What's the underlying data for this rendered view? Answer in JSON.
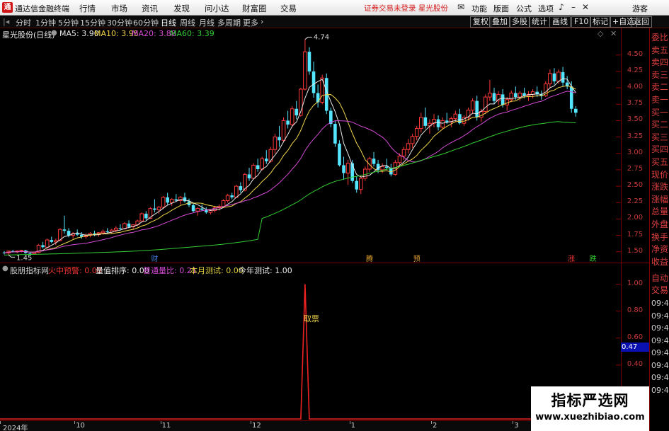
{
  "window": {
    "title": "通达信金融终端",
    "menu": [
      "行情",
      "市场",
      "资讯",
      "发现",
      "问小达",
      "财富圈",
      "交易"
    ],
    "notice": "证券交易未登录  星光股份",
    "right_menu": [
      "功能",
      "版面",
      "公式",
      "选项"
    ],
    "user": "游客"
  },
  "toolbar": {
    "periods": [
      "分时",
      "1分钟",
      "5分钟",
      "15分钟",
      "30分钟",
      "60分钟",
      "日线",
      "周线",
      "月线",
      "多周期",
      "更多"
    ],
    "active_period": "日线",
    "right_buttons": [
      "复权",
      "叠加",
      "多股",
      "统计",
      "画线",
      "F10",
      "标记",
      "+自选",
      "返回"
    ]
  },
  "main_chart": {
    "stock_label": "星光股份(日线)",
    "ma_legend": [
      {
        "label": "MA5: 3.90",
        "color": "#e8e8e8"
      },
      {
        "label": "MA10: 3.95",
        "color": "#f0d64a"
      },
      {
        "label": "MA20: 3.88",
        "color": "#d44ad4"
      },
      {
        "label": "MA60: 3.39",
        "color": "#33cc33"
      }
    ],
    "high_label": "4.74",
    "low_label": "1.45",
    "event_markers": [
      {
        "text": "财",
        "color": "#3a7ad8",
        "x_index": 35
      },
      {
        "text": "腾",
        "color": "#e0a030",
        "x_index": 85
      },
      {
        "text": "预",
        "color": "#e0a030",
        "x_index": 96
      },
      {
        "text": "涨",
        "color": "#ee3333",
        "x_index": 132
      },
      {
        "text": "跌",
        "color": "#33cc33",
        "x_index": 137
      }
    ]
  },
  "price_axis": [
    "4.50",
    "4.25",
    "4.00",
    "3.75",
    "3.50",
    "3.25",
    "3.00",
    "2.75",
    "2.50",
    "2.25",
    "2.00",
    "1.75",
    "1.50"
  ],
  "indicator": {
    "legend": [
      {
        "label": "股朋指标网",
        "color": "#cccccc"
      },
      {
        "label": "火中预警: 0.00",
        "color": "#ee3333"
      },
      {
        "label": "量值排序: 0.00",
        "color": "#e8e8e8"
      },
      {
        "label": "普通量比: 0.21",
        "color": "#d44ad4"
      },
      {
        "label": "本月测试: 0.00",
        "color": "#e0d040"
      },
      {
        "label": "今年测试: 1.00",
        "color": "#e8e8e8"
      }
    ],
    "axis": [
      "1.00",
      "0.80",
      "0.60",
      "0.40",
      "0.20",
      "0.00"
    ],
    "current_value": "0.47",
    "peak_label": "取票"
  },
  "right_panel": {
    "quote_labels": [
      "委比",
      "卖五",
      "卖四",
      "卖三",
      "卖二",
      "卖一",
      "买一",
      "买二",
      "买三",
      "买四",
      "买五",
      "现价",
      "涨跌",
      "涨幅",
      "总量",
      "外盘",
      "换手",
      "净资",
      "收益"
    ],
    "trade_labels": [
      "自动",
      "交易"
    ],
    "times": [
      "09:43",
      "09:43",
      "09:43",
      "09:43",
      "09:43",
      "09:43",
      "09:43",
      "09:43"
    ]
  },
  "date_axis": [
    {
      "label": "2024年",
      "x_index": 0
    },
    {
      "label": "10",
      "x_index": 17
    },
    {
      "label": "11",
      "x_index": 37
    },
    {
      "label": "12",
      "x_index": 58
    },
    {
      "label": "1",
      "x_index": 81
    },
    {
      "label": "2",
      "x_index": 100
    },
    {
      "label": "3",
      "x_index": 119
    }
  ],
  "watermark": {
    "title": "指标严选网",
    "url": "www.xuezhibiao.com"
  },
  "chart_data": {
    "type": "candlestick",
    "ylim": [
      1.4,
      4.8
    ],
    "candles_ohlc": [
      [
        1.49,
        1.51,
        1.46,
        1.48
      ],
      [
        1.48,
        1.52,
        1.45,
        1.51
      ],
      [
        1.51,
        1.53,
        1.49,
        1.5
      ],
      [
        1.5,
        1.52,
        1.48,
        1.51
      ],
      [
        1.51,
        1.53,
        1.49,
        1.52
      ],
      [
        1.52,
        1.53,
        1.47,
        1.48
      ],
      [
        1.48,
        1.5,
        1.45,
        1.47
      ],
      [
        1.47,
        1.5,
        1.46,
        1.49
      ],
      [
        1.49,
        1.62,
        1.48,
        1.6
      ],
      [
        1.6,
        1.65,
        1.55,
        1.57
      ],
      [
        1.57,
        1.7,
        1.55,
        1.68
      ],
      [
        1.68,
        1.73,
        1.63,
        1.65
      ],
      [
        1.65,
        1.7,
        1.6,
        1.67
      ],
      [
        1.67,
        1.86,
        1.66,
        1.84
      ],
      [
        1.84,
        2.05,
        1.78,
        1.82
      ],
      [
        1.82,
        1.86,
        1.72,
        1.75
      ],
      [
        1.75,
        1.8,
        1.7,
        1.78
      ],
      [
        1.78,
        1.84,
        1.74,
        1.76
      ],
      [
        1.76,
        1.8,
        1.7,
        1.73
      ],
      [
        1.73,
        1.78,
        1.7,
        1.75
      ],
      [
        1.75,
        1.8,
        1.72,
        1.78
      ],
      [
        1.78,
        1.82,
        1.74,
        1.76
      ],
      [
        1.76,
        1.8,
        1.73,
        1.79
      ],
      [
        1.79,
        1.84,
        1.76,
        1.81
      ],
      [
        1.81,
        1.86,
        1.78,
        1.8
      ],
      [
        1.8,
        1.85,
        1.77,
        1.83
      ],
      [
        1.83,
        1.89,
        1.8,
        1.86
      ],
      [
        1.86,
        1.92,
        1.83,
        1.85
      ],
      [
        1.85,
        1.95,
        1.84,
        1.93
      ],
      [
        1.93,
        1.98,
        1.86,
        1.88
      ],
      [
        1.88,
        1.92,
        1.85,
        1.91
      ],
      [
        1.91,
        1.99,
        1.89,
        1.97
      ],
      [
        1.97,
        2.1,
        1.96,
        2.08
      ],
      [
        2.08,
        2.12,
        1.98,
        2.01
      ],
      [
        2.01,
        2.18,
        2.0,
        2.16
      ],
      [
        2.16,
        2.3,
        2.1,
        2.14
      ],
      [
        2.14,
        2.2,
        2.08,
        2.18
      ],
      [
        2.18,
        2.35,
        2.15,
        2.33
      ],
      [
        2.33,
        2.4,
        2.22,
        2.25
      ],
      [
        2.25,
        2.32,
        2.2,
        2.3
      ],
      [
        2.3,
        2.38,
        2.26,
        2.28
      ],
      [
        2.28,
        2.35,
        2.22,
        2.33
      ],
      [
        2.33,
        2.4,
        2.25,
        2.27
      ],
      [
        2.27,
        2.31,
        2.18,
        2.21
      ],
      [
        2.21,
        2.25,
        2.1,
        2.12
      ],
      [
        2.12,
        2.18,
        2.05,
        2.16
      ],
      [
        2.16,
        2.22,
        2.12,
        2.14
      ],
      [
        2.14,
        2.18,
        2.08,
        2.1
      ],
      [
        2.1,
        2.15,
        2.07,
        2.13
      ],
      [
        2.13,
        2.2,
        2.1,
        2.17
      ],
      [
        2.17,
        2.22,
        2.13,
        2.19
      ],
      [
        2.19,
        2.3,
        2.17,
        2.28
      ],
      [
        2.28,
        2.38,
        2.25,
        2.36
      ],
      [
        2.36,
        2.4,
        2.3,
        2.33
      ],
      [
        2.33,
        2.52,
        2.32,
        2.5
      ],
      [
        2.5,
        2.56,
        2.4,
        2.44
      ],
      [
        2.44,
        2.7,
        2.42,
        2.68
      ],
      [
        2.68,
        2.78,
        2.58,
        2.62
      ],
      [
        2.62,
        2.85,
        2.6,
        2.82
      ],
      [
        2.82,
        2.92,
        2.72,
        2.76
      ],
      [
        2.76,
        2.95,
        2.74,
        2.92
      ],
      [
        2.92,
        3.05,
        2.84,
        2.88
      ],
      [
        2.88,
        3.1,
        2.86,
        3.06
      ],
      [
        3.06,
        3.3,
        3.0,
        3.25
      ],
      [
        3.25,
        3.42,
        3.1,
        3.2
      ],
      [
        3.2,
        3.55,
        3.18,
        3.5
      ],
      [
        3.5,
        3.65,
        3.38,
        3.44
      ],
      [
        3.44,
        3.72,
        3.4,
        3.68
      ],
      [
        3.68,
        3.8,
        3.52,
        3.58
      ],
      [
        3.58,
        4.0,
        3.56,
        3.98
      ],
      [
        3.98,
        4.74,
        3.96,
        4.55
      ],
      [
        4.55,
        4.62,
        4.2,
        4.25
      ],
      [
        4.25,
        4.4,
        3.85,
        3.92
      ],
      [
        3.92,
        4.05,
        3.7,
        3.78
      ],
      [
        3.78,
        4.2,
        3.75,
        4.15
      ],
      [
        4.15,
        4.22,
        3.6,
        3.65
      ],
      [
        3.65,
        3.7,
        3.4,
        3.45
      ],
      [
        3.45,
        3.5,
        3.1,
        3.15
      ],
      [
        3.15,
        3.2,
        2.8,
        2.82
      ],
      [
        2.82,
        2.95,
        2.6,
        2.7
      ],
      [
        2.7,
        2.9,
        2.52,
        2.85
      ],
      [
        2.85,
        2.9,
        2.55,
        2.58
      ],
      [
        2.58,
        2.65,
        2.4,
        2.45
      ],
      [
        2.45,
        2.66,
        2.38,
        2.62
      ],
      [
        2.62,
        2.8,
        2.58,
        2.76
      ],
      [
        2.76,
        2.95,
        2.72,
        2.92
      ],
      [
        2.92,
        3.02,
        2.8,
        2.84
      ],
      [
        2.84,
        2.9,
        2.7,
        2.75
      ],
      [
        2.75,
        2.85,
        2.7,
        2.8
      ],
      [
        2.8,
        2.92,
        2.75,
        2.78
      ],
      [
        2.78,
        2.84,
        2.65,
        2.68
      ],
      [
        2.68,
        2.9,
        2.66,
        2.86
      ],
      [
        2.86,
        3.0,
        2.82,
        2.96
      ],
      [
        2.96,
        3.1,
        2.9,
        3.06
      ],
      [
        3.06,
        3.22,
        3.0,
        3.15
      ],
      [
        3.15,
        3.3,
        3.08,
        3.26
      ],
      [
        3.26,
        3.42,
        3.2,
        3.38
      ],
      [
        3.38,
        3.62,
        3.32,
        3.55
      ],
      [
        3.55,
        3.7,
        3.38,
        3.42
      ],
      [
        3.42,
        3.52,
        3.3,
        3.46
      ],
      [
        3.46,
        3.6,
        3.4,
        3.52
      ],
      [
        3.52,
        3.58,
        3.35,
        3.4
      ],
      [
        3.4,
        3.55,
        3.36,
        3.5
      ],
      [
        3.5,
        3.62,
        3.45,
        3.48
      ],
      [
        3.48,
        3.56,
        3.4,
        3.53
      ],
      [
        3.53,
        3.65,
        3.48,
        3.6
      ],
      [
        3.6,
        3.68,
        3.44,
        3.46
      ],
      [
        3.46,
        3.58,
        3.42,
        3.55
      ],
      [
        3.55,
        3.7,
        3.5,
        3.66
      ],
      [
        3.66,
        3.84,
        3.6,
        3.8
      ],
      [
        3.8,
        3.88,
        3.5,
        3.55
      ],
      [
        3.55,
        3.68,
        3.48,
        3.64
      ],
      [
        3.64,
        3.9,
        3.6,
        3.86
      ],
      [
        3.86,
        4.12,
        3.8,
        3.92
      ],
      [
        3.92,
        4.0,
        3.75,
        3.8
      ],
      [
        3.8,
        3.95,
        3.74,
        3.9
      ],
      [
        3.9,
        3.98,
        3.7,
        3.74
      ],
      [
        3.74,
        3.86,
        3.65,
        3.82
      ],
      [
        3.82,
        3.96,
        3.78,
        3.92
      ],
      [
        3.92,
        4.02,
        3.82,
        3.86
      ],
      [
        3.86,
        3.95,
        3.8,
        3.92
      ],
      [
        3.92,
        4.0,
        3.84,
        3.88
      ],
      [
        3.88,
        3.95,
        3.8,
        3.9
      ],
      [
        3.9,
        3.98,
        3.84,
        3.94
      ],
      [
        3.94,
        4.02,
        3.86,
        3.9
      ],
      [
        3.9,
        3.96,
        3.82,
        3.88
      ],
      [
        3.88,
        4.1,
        3.86,
        4.06
      ],
      [
        4.06,
        4.28,
        4.0,
        4.22
      ],
      [
        4.22,
        4.3,
        4.05,
        4.1
      ],
      [
        4.1,
        4.28,
        4.06,
        4.24
      ],
      [
        4.24,
        4.32,
        4.02,
        4.08
      ],
      [
        4.08,
        4.18,
        3.98,
        4.02
      ],
      [
        4.02,
        4.1,
        3.62,
        3.68
      ],
      [
        3.68,
        3.72,
        3.56,
        3.62
      ]
    ],
    "ma_series": [
      {
        "name": "MA5",
        "color": "#e8e8e8",
        "period": 5
      },
      {
        "name": "MA10",
        "color": "#f0d64a",
        "period": 10
      },
      {
        "name": "MA20",
        "color": "#d44ad4",
        "period": 20
      },
      {
        "name": "MA60",
        "color": "#33cc33",
        "period": 60
      }
    ],
    "ma60_warmup": [
      1.45,
      1.54
    ],
    "indicator_series": {
      "ylim": [
        0,
        1.05
      ],
      "spike_index": 70,
      "spike_value": 1.0,
      "line_color": "#ee2222"
    }
  }
}
